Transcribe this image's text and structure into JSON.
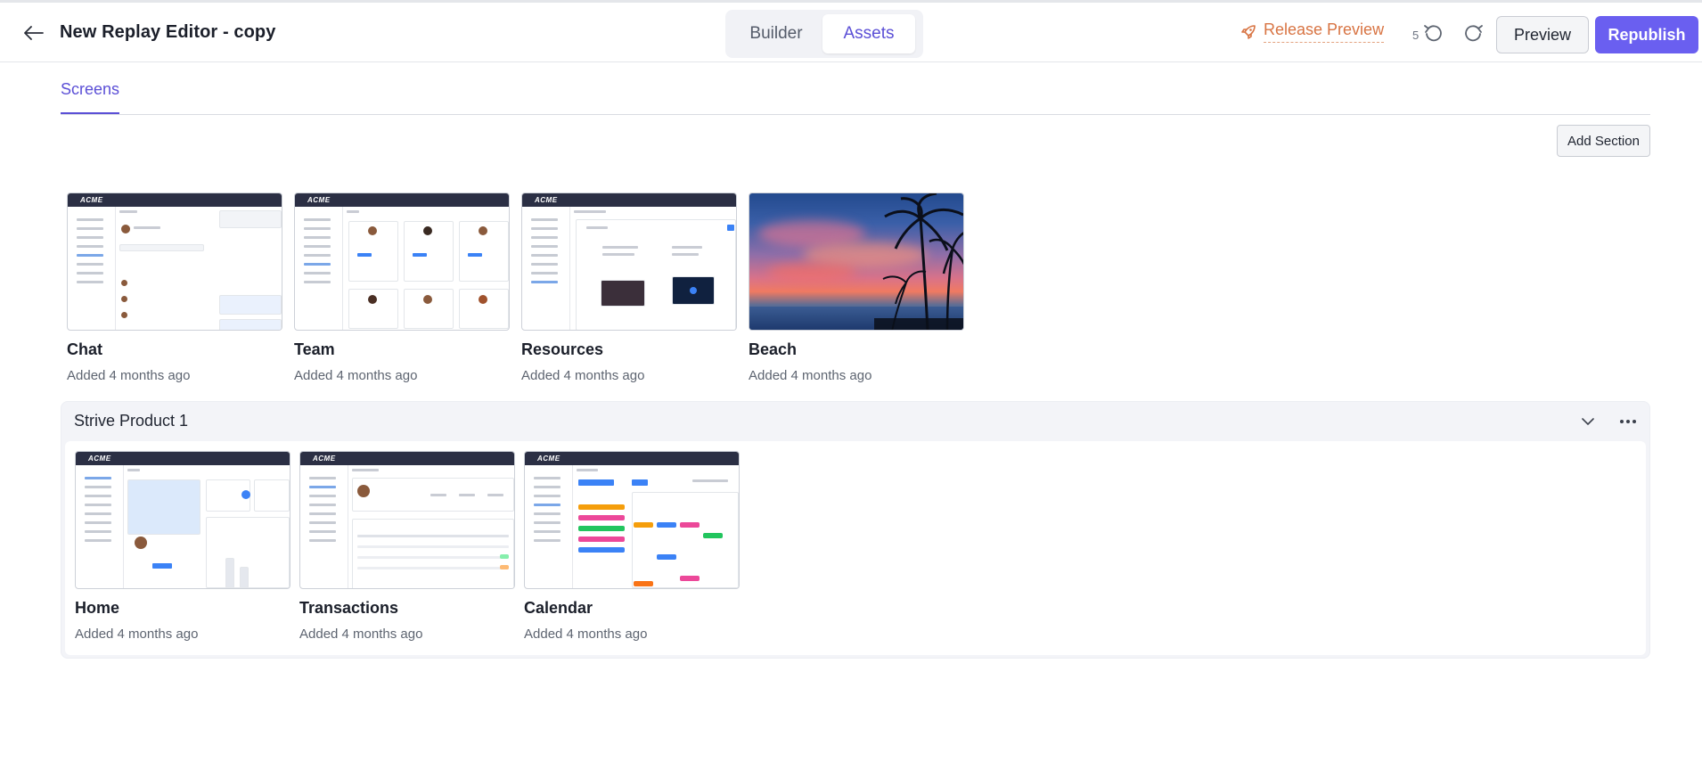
{
  "header": {
    "title": "New Replay Editor - copy",
    "tabs": [
      {
        "label": "Builder",
        "active": false
      },
      {
        "label": "Assets",
        "active": true
      }
    ],
    "release_preview": "Release Preview",
    "undo_count": "5",
    "preview_label": "Preview",
    "republish_label": "Republish"
  },
  "subtabs": {
    "screens": "Screens"
  },
  "add_section_label": "Add Section",
  "screens": [
    {
      "name": "Chat",
      "added": "Added 4 months ago",
      "thumb": "acme-chat"
    },
    {
      "name": "Team",
      "added": "Added 4 months ago",
      "thumb": "acme-team"
    },
    {
      "name": "Resources",
      "added": "Added 4 months ago",
      "thumb": "acme-resources"
    },
    {
      "name": "Beach",
      "added": "Added 4 months ago",
      "thumb": "beach-photo"
    }
  ],
  "section": {
    "title": "Strive Product 1",
    "screens": [
      {
        "name": "Home",
        "added": "Added 4 months ago",
        "thumb": "acme-home"
      },
      {
        "name": "Transactions",
        "added": "Added 4 months ago",
        "thumb": "acme-transactions"
      },
      {
        "name": "Calendar",
        "added": "Added 4 months ago",
        "thumb": "acme-calendar"
      }
    ]
  },
  "thumb_brand": "ACME",
  "colors": {
    "accent": "#6a5ff0",
    "tab_active": "#5b4fd6",
    "release": "#d87443",
    "mock_header": "#2b2f44"
  }
}
